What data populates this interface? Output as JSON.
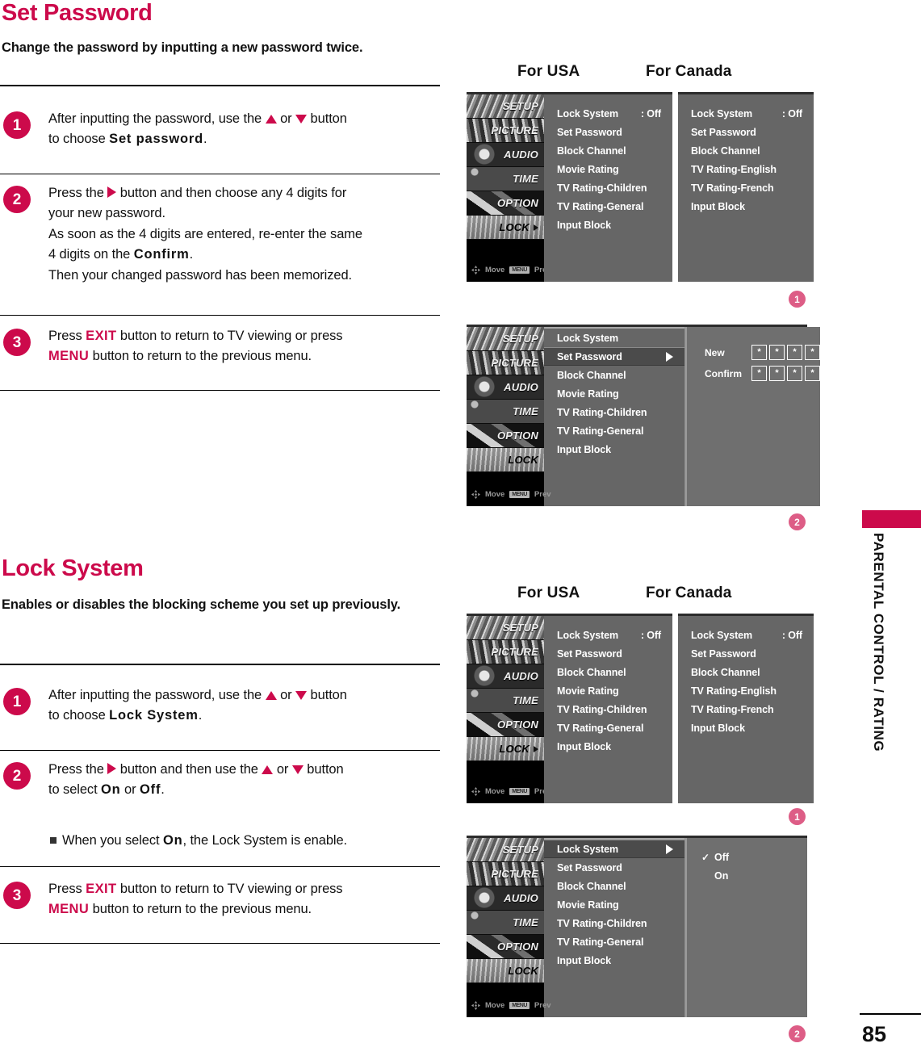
{
  "page": {
    "number": "85",
    "side_tab_label": "PARENTAL CONTROL / RATING"
  },
  "sections": [
    {
      "title": "Set Password",
      "subtitle": "Change the password by inputting a new password twice.",
      "steps": [
        {
          "number": "1",
          "lines": [
            {
              "parts": [
                {
                  "t": "After inputting the password, use the ",
                  "s": "plain"
                },
                {
                  "t": "▲",
                  "s": "tri-up"
                },
                {
                  "t": " or ",
                  "s": "plain"
                },
                {
                  "t": "▼",
                  "s": "tri-down"
                },
                {
                  "t": " button",
                  "s": "plain"
                }
              ]
            },
            {
              "parts": [
                {
                  "t": "to choose ",
                  "s": "plain"
                },
                {
                  "t": "Set password",
                  "s": "spaced"
                },
                {
                  "t": ".",
                  "s": "plain"
                }
              ]
            }
          ]
        },
        {
          "number": "2",
          "lines": [
            {
              "parts": [
                {
                  "t": "Press the ",
                  "s": "plain"
                },
                {
                  "t": "▶",
                  "s": "tri-right"
                },
                {
                  "t": " button and then choose any 4 digits for",
                  "s": "plain"
                }
              ]
            },
            {
              "parts": [
                {
                  "t": "your new password.",
                  "s": "plain"
                }
              ]
            },
            {
              "parts": [
                {
                  "t": "As soon as the 4 digits are entered, re-enter the same",
                  "s": "plain"
                }
              ]
            },
            {
              "parts": [
                {
                  "t": "4 digits on the ",
                  "s": "plain"
                },
                {
                  "t": "Confirm",
                  "s": "spaced"
                },
                {
                  "t": ".",
                  "s": "plain"
                }
              ]
            },
            {
              "parts": [
                {
                  "t": "Then your changed password has been memorized.",
                  "s": "plain"
                }
              ]
            }
          ]
        },
        {
          "number": "3",
          "lines": [
            {
              "parts": [
                {
                  "t": "Press ",
                  "s": "plain"
                },
                {
                  "t": "EXIT",
                  "s": "pink"
                },
                {
                  "t": " button to return to TV viewing or press",
                  "s": "plain"
                }
              ]
            },
            {
              "parts": [
                {
                  "t": "MENU",
                  "s": "pink"
                },
                {
                  "t": " button to return to the previous menu.",
                  "s": "plain"
                }
              ]
            }
          ]
        }
      ]
    },
    {
      "title": "Lock System",
      "subtitle": "Enables or disables the blocking scheme you set up previously.",
      "steps": [
        {
          "number": "1",
          "lines": [
            {
              "parts": [
                {
                  "t": "After inputting the password, use the ",
                  "s": "plain"
                },
                {
                  "t": "▲",
                  "s": "tri-up"
                },
                {
                  "t": " or ",
                  "s": "plain"
                },
                {
                  "t": "▼",
                  "s": "tri-down"
                },
                {
                  "t": " button",
                  "s": "plain"
                }
              ]
            },
            {
              "parts": [
                {
                  "t": "to choose ",
                  "s": "plain"
                },
                {
                  "t": "Lock System",
                  "s": "spaced"
                },
                {
                  "t": ".",
                  "s": "plain"
                }
              ]
            }
          ]
        },
        {
          "number": "2",
          "lines": [
            {
              "parts": [
                {
                  "t": "Press the ",
                  "s": "plain"
                },
                {
                  "t": "▶",
                  "s": "tri-right"
                },
                {
                  "t": " button and then use the ",
                  "s": "plain"
                },
                {
                  "t": "▲",
                  "s": "tri-up"
                },
                {
                  "t": " or ",
                  "s": "plain"
                },
                {
                  "t": "▼",
                  "s": "tri-down"
                },
                {
                  "t": " button",
                  "s": "plain"
                }
              ]
            },
            {
              "parts": [
                {
                  "t": "to select ",
                  "s": "plain"
                },
                {
                  "t": "On",
                  "s": "spaced"
                },
                {
                  "t": " or ",
                  "s": "plain"
                },
                {
                  "t": "Off",
                  "s": "spaced"
                },
                {
                  "t": ".",
                  "s": "plain"
                }
              ]
            }
          ],
          "note": {
            "parts": [
              {
                "t": "When you select ",
                "s": "plain"
              },
              {
                "t": "On",
                "s": "spaced"
              },
              {
                "t": ", the Lock System is enable.",
                "s": "plain"
              }
            ]
          }
        },
        {
          "number": "3",
          "lines": [
            {
              "parts": [
                {
                  "t": "Press ",
                  "s": "plain"
                },
                {
                  "t": "EXIT",
                  "s": "pink"
                },
                {
                  "t": " button to return to TV viewing or press",
                  "s": "plain"
                }
              ]
            },
            {
              "parts": [
                {
                  "t": "MENU",
                  "s": "pink"
                },
                {
                  "t": " button to return to the previous menu.",
                  "s": "plain"
                }
              ]
            }
          ]
        }
      ]
    }
  ],
  "osd": {
    "region_labels": {
      "usa": "For USA",
      "canada": "For Canada"
    },
    "sidebar": {
      "items": [
        {
          "label": "SETUP",
          "active": false
        },
        {
          "label": "PICTURE",
          "active": false
        },
        {
          "label": "AUDIO",
          "active": false
        },
        {
          "label": "TIME",
          "active": false
        },
        {
          "label": "OPTION",
          "active": false
        },
        {
          "label": "LOCK",
          "active": true
        }
      ],
      "footer": {
        "move": "Move",
        "menu_key": "MENU",
        "prev": "Prev"
      }
    },
    "usa_menu": {
      "rows": [
        {
          "label": "Lock System",
          "value": ": Off"
        },
        {
          "label": "Set Password",
          "value": ""
        },
        {
          "label": "Block Channel",
          "value": ""
        },
        {
          "label": "Movie Rating",
          "value": ""
        },
        {
          "label": "TV Rating-Children",
          "value": ""
        },
        {
          "label": "TV Rating-General",
          "value": ""
        },
        {
          "label": "Input Block",
          "value": ""
        }
      ]
    },
    "canada_menu": {
      "rows": [
        {
          "label": "Lock System",
          "value": ": Off"
        },
        {
          "label": "Set Password",
          "value": ""
        },
        {
          "label": "Block Channel",
          "value": ""
        },
        {
          "label": "TV Rating-English",
          "value": ""
        },
        {
          "label": "TV Rating-French",
          "value": ""
        },
        {
          "label": "Input Block",
          "value": ""
        }
      ]
    },
    "password_menu": {
      "rows": [
        {
          "label": "Lock System",
          "selected": false,
          "arrow": false
        },
        {
          "label": "Set Password",
          "selected": true,
          "arrow": true
        },
        {
          "label": "Block Channel",
          "selected": false,
          "arrow": false
        },
        {
          "label": "Movie Rating",
          "selected": false,
          "arrow": false
        },
        {
          "label": "TV Rating-Children",
          "selected": false,
          "arrow": false
        },
        {
          "label": "TV Rating-General",
          "selected": false,
          "arrow": false
        },
        {
          "label": "Input Block",
          "selected": false,
          "arrow": false
        }
      ],
      "fields": [
        {
          "label": "New",
          "digits": [
            "*",
            "*",
            "*",
            "*"
          ]
        },
        {
          "label": "Confirm",
          "digits": [
            "*",
            "*",
            "*",
            "*"
          ]
        }
      ]
    },
    "lock_menu": {
      "rows": [
        {
          "label": "Lock System",
          "selected": true,
          "arrow": true
        },
        {
          "label": "Set Password",
          "selected": false,
          "arrow": false
        },
        {
          "label": "Block Channel",
          "selected": false,
          "arrow": false
        },
        {
          "label": "Movie Rating",
          "selected": false,
          "arrow": false
        },
        {
          "label": "TV Rating-Children",
          "selected": false,
          "arrow": false
        },
        {
          "label": "TV Rating-General",
          "selected": false,
          "arrow": false
        },
        {
          "label": "Input Block",
          "selected": false,
          "arrow": false
        }
      ],
      "options": [
        {
          "label": "Off",
          "checked": true
        },
        {
          "label": "On",
          "checked": false
        }
      ]
    },
    "callouts": {
      "one": "1",
      "two": "2"
    }
  },
  "colors": {
    "brand_pink": "#cc0a4b",
    "callout_pink": "#dd5d86",
    "osd_panel": "#666666",
    "osd_selected": "#4b4b4b"
  }
}
